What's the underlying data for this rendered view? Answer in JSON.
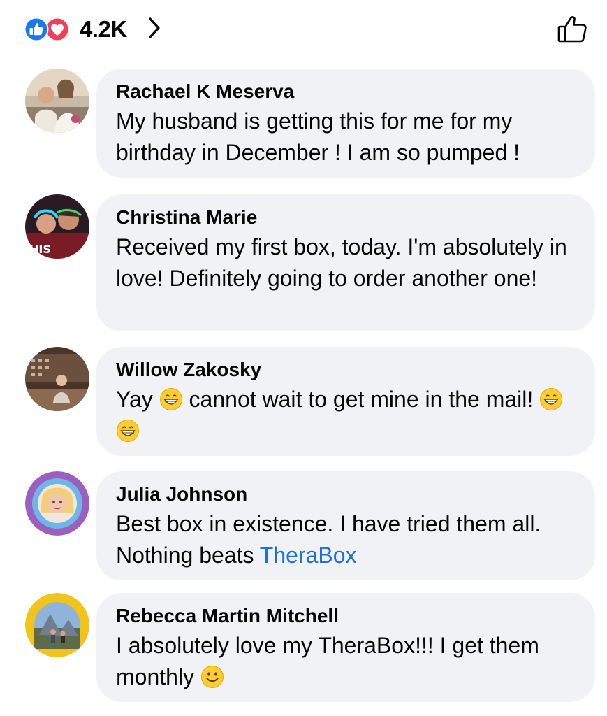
{
  "reactions": {
    "count": "4.2K",
    "types": [
      "like-icon",
      "love-icon"
    ],
    "colors": {
      "like": "#1877f2",
      "love": "#f33e58"
    }
  },
  "comments": [
    {
      "author": "Rachael K Meserva",
      "text": "My husband is getting this for me for my birthday in December ! I am so pumped !"
    },
    {
      "author": "Christina Marie",
      "text": "Received my first box, today.  I'm absolutely in love!  Definitely going to order another one!"
    },
    {
      "author": "Willow Zakosky",
      "text_parts": [
        "Yay ",
        " cannot wait to get mine in the mail! "
      ],
      "emojis": [
        "grinning-face-icon",
        "grinning-face-icon",
        "grinning-face-icon"
      ]
    },
    {
      "author": "Julia Johnson",
      "text": "Best box in existence.  I have tried them all. Nothing beats ",
      "link": "TheraBox"
    },
    {
      "author": "Rebecca Martin Mitchell",
      "text": "I absolutely love my TheraBox!!! I get them monthly ",
      "emojis": [
        "smiling-face-icon"
      ]
    }
  ],
  "theme": {
    "bubble_bg": "#f0f2f5",
    "link_color": "#216fdb"
  }
}
